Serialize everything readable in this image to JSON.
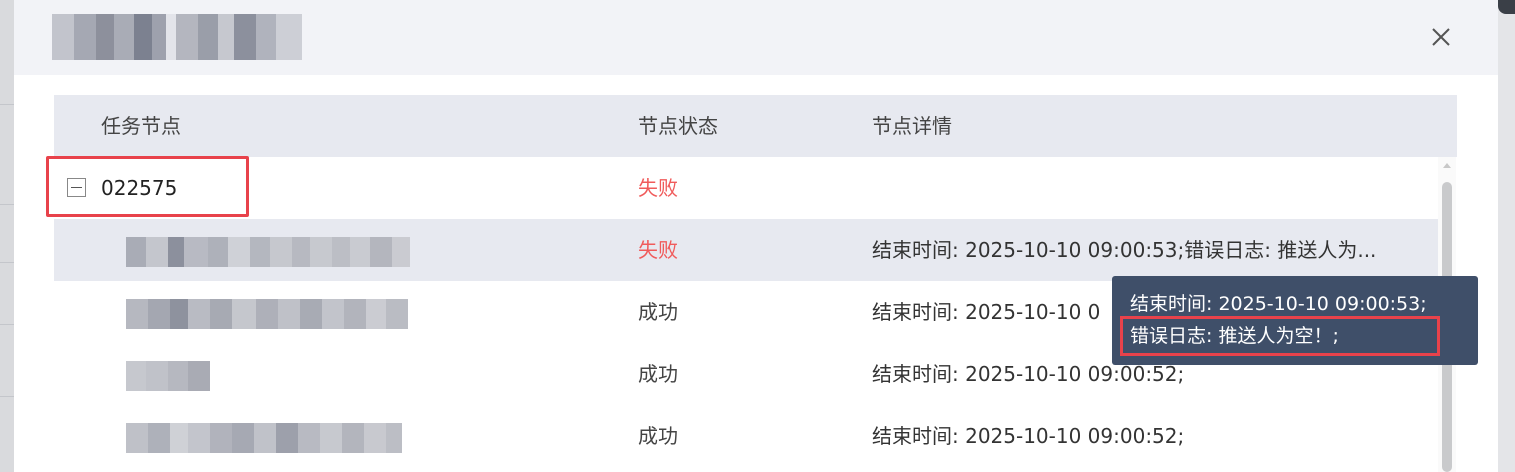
{
  "dialog": {
    "title_blurred": true
  },
  "table": {
    "columns": [
      "任务节点",
      "节点状态",
      "节点详情"
    ],
    "rows": [
      {
        "node": "022575",
        "status": "失败",
        "detail": "",
        "status_type": "fail"
      },
      {
        "node": "",
        "status": "失败",
        "detail": "结束时间: 2025-10-10 09:00:53;错误日志: 推送人为...",
        "status_type": "fail"
      },
      {
        "node": "",
        "status": "成功",
        "detail": "结束时间: 2025-10-10 0",
        "status_type": "ok"
      },
      {
        "node": "",
        "status": "成功",
        "detail": "结束时间: 2025-10-10 09:00:52;",
        "status_type": "ok"
      },
      {
        "node": "",
        "status": "成功",
        "detail": "结束时间: 2025-10-10 09:00:52;",
        "status_type": "ok"
      }
    ]
  },
  "tooltip": {
    "line1": "结束时间: 2025-10-10 09:00:53;",
    "line2": "错误日志: 推送人为空！;"
  },
  "icons": {
    "close": "close-icon",
    "collapse": "minus-square-icon"
  },
  "colors": {
    "fail": "#f05b5b",
    "highlight": "#e8424b",
    "tooltip_bg": "#3f4f69",
    "header_bg": "#e7e9f0"
  }
}
